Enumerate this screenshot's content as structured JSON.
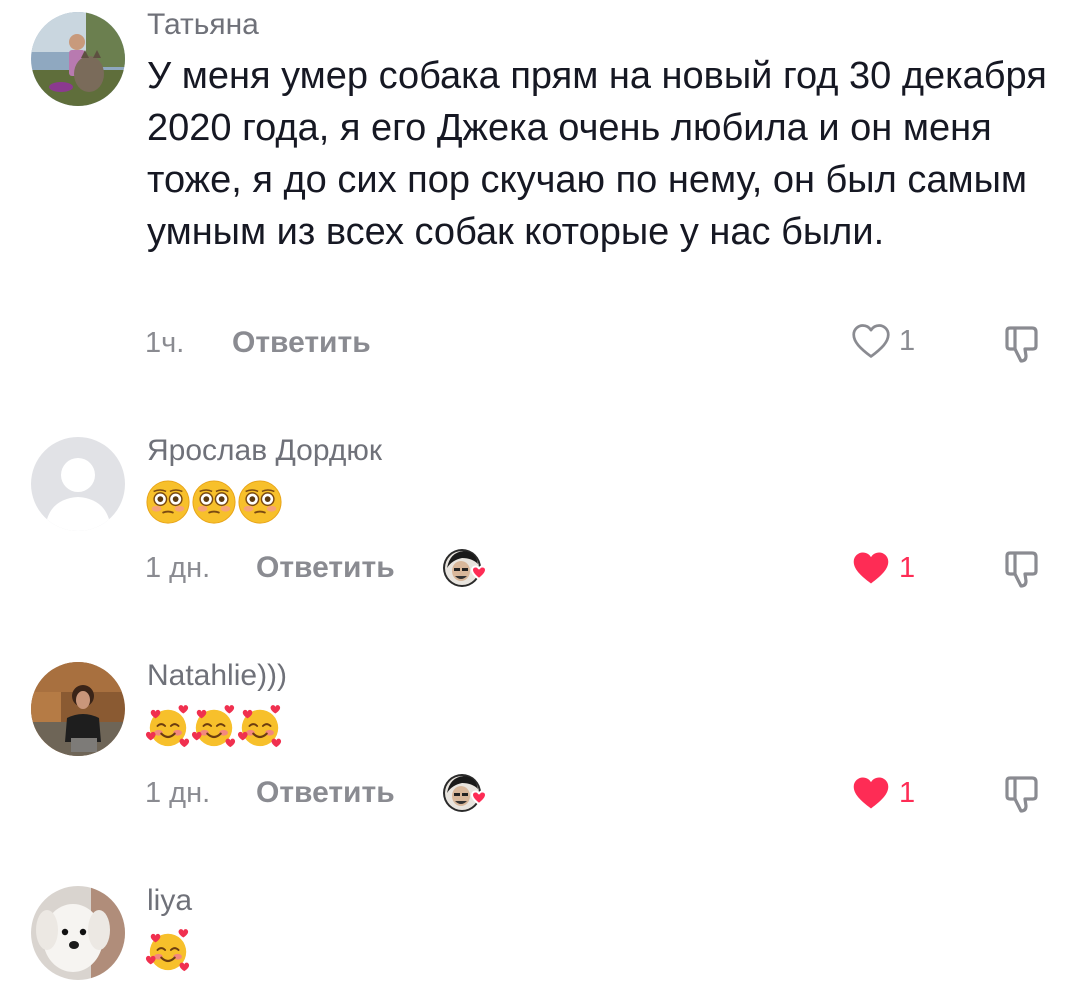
{
  "comments": [
    {
      "username": "Татьяна",
      "text": "У меня умер собака прям на новый год 30 декабря 2020 года, я его Джека очень любила и он меня тоже, я до сих пор скучаю по нему, он был самым умным из всех собак которые у нас были.",
      "time": "1ч.",
      "reply_label": "Ответить",
      "likes": "1",
      "liked": false
    },
    {
      "username": "Ярослав Дордюк",
      "emoji": "flushed-face",
      "emoji_count": 3,
      "time": "1 дн.",
      "reply_label": "Ответить",
      "likes": "1",
      "liked": true
    },
    {
      "username": "Natahlie)))",
      "emoji": "smiling-face-with-hearts",
      "emoji_count": 3,
      "time": "1 дн.",
      "reply_label": "Ответить",
      "likes": "1",
      "liked": true
    },
    {
      "username": "liya",
      "emoji": "smiling-face-with-hearts",
      "emoji_count": 1
    }
  ],
  "colors": {
    "like_active": "#fe2c55",
    "muted_text": "#8a8b91",
    "username_text": "#6f7179",
    "body_text": "#161823"
  }
}
